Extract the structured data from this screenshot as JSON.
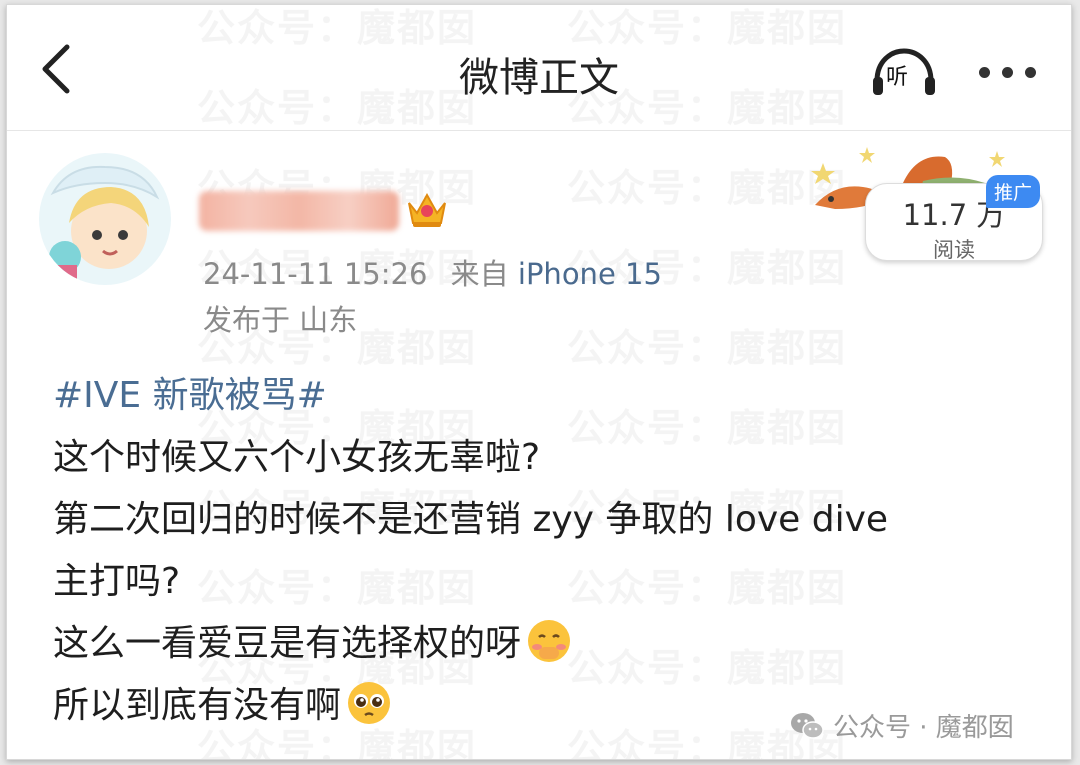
{
  "header": {
    "title": "微博正文",
    "listen_label": "听"
  },
  "watermark_text": "公众号：魔都囡",
  "author": {
    "posted_at": "24-11-11 15:26",
    "source_prefix": "来自",
    "source": "iPhone 15",
    "location": "发布于 山东"
  },
  "promo": {
    "tag": "推广",
    "read_count": "11.7 万",
    "read_label": "阅读"
  },
  "post": {
    "topic": "#IVE 新歌被骂#",
    "lines": [
      "这个时候又六个小女孩无辜啦?",
      "第二次回归的时候不是还营销 zyy 争取的 love dive",
      "主打吗?",
      "这么一看爱豆是有选择权的呀",
      "所以到底有没有啊"
    ]
  },
  "footer": {
    "brand": "公众号 · 魔都囡"
  }
}
